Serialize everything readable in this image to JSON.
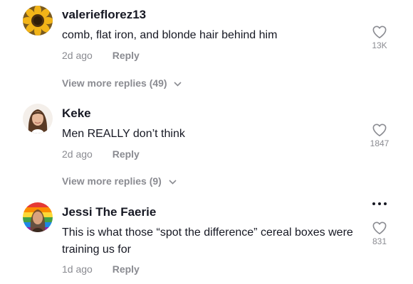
{
  "comments": [
    {
      "username": "valerieflorez13",
      "text": "comb, flat iron, and blonde hair behind him",
      "time": "2d ago",
      "reply_label": "Reply",
      "likes": "13K",
      "view_more": "View more replies (49)",
      "avatar_icon": "sunflower-avatar"
    },
    {
      "username": "Keke",
      "text": "Men REALLY don’t think",
      "time": "2d ago",
      "reply_label": "Reply",
      "likes": "1847",
      "view_more": "View more replies (9)",
      "avatar_icon": "woman-portrait-avatar"
    },
    {
      "username": "Jessi The Faerie",
      "text": "This is what those “spot the difference” cereal boxes were training us for",
      "time": "1d ago",
      "reply_label": "Reply",
      "likes": "831",
      "avatar_icon": "rainbow-portrait-avatar"
    }
  ],
  "colors": {
    "text_primary": "#161823",
    "text_secondary": "#8a8b91",
    "background": "#ffffff"
  }
}
